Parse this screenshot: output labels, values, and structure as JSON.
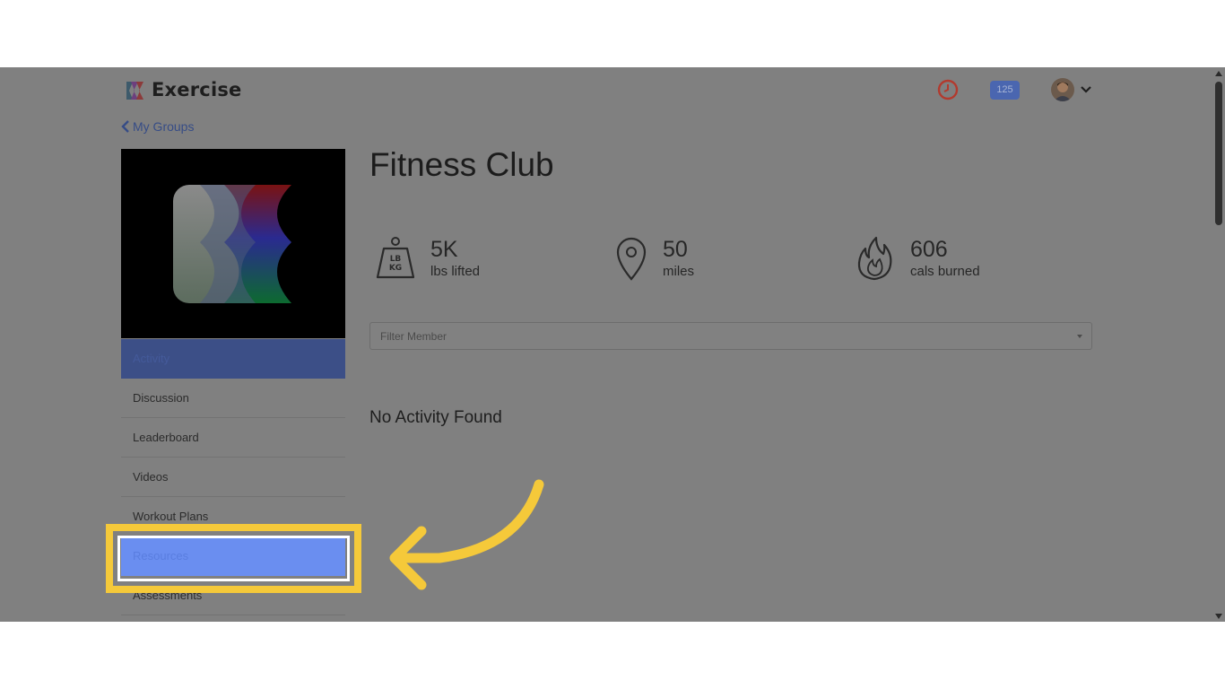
{
  "app": {
    "title": "Exercise"
  },
  "header": {
    "notification_count": "125",
    "icons": {
      "clock": "clock-icon",
      "avatar": "avatar",
      "dropdown": "chevron-down-icon"
    }
  },
  "nav": {
    "back_label": "My Groups"
  },
  "group": {
    "name": "Fitness Club"
  },
  "stats": [
    {
      "value": "5K",
      "label": "lbs lifted",
      "icon": "weight-icon",
      "icon_text_top": "LB",
      "icon_text_bottom": "KG"
    },
    {
      "value": "50",
      "label": "miles",
      "icon": "map-pin-icon"
    },
    {
      "value": "606",
      "label": "cals burned",
      "icon": "flame-icon"
    }
  ],
  "sidebar": {
    "items": [
      {
        "label": "Activity",
        "state": "active"
      },
      {
        "label": "Discussion"
      },
      {
        "label": "Leaderboard"
      },
      {
        "label": "Videos"
      },
      {
        "label": "Workout Plans"
      },
      {
        "label": "Resources",
        "state": "highlighted"
      },
      {
        "label": "Assessments"
      }
    ]
  },
  "filter": {
    "placeholder": "Filter Member"
  },
  "activity": {
    "empty_message": "No Activity Found"
  },
  "colors": {
    "overlay": "#808080",
    "callout": "#f5c93a",
    "highlight": "#6a8ef0",
    "badge": "#4a66b0"
  }
}
